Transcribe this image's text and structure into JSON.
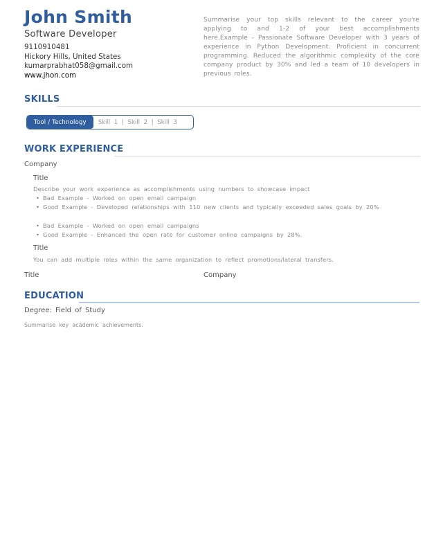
{
  "header": {
    "name": "John Smith",
    "role": "Software Developer",
    "phone": "9110910481",
    "location": "Hickory Hills, United States",
    "email": "kumarprabhat058@gmail.com",
    "website": "www.jhon.com",
    "summary": "Summarise your top skills relevant to the career you're applying to and 1-2 of your best accomplishments here.Example - Passionate Software Developer with 3 years of experience in Python Development. Proficient in concurrent programming. Reduced the algorithmic complexity of the core company product by 30% and led a team of 10 developers in previous roles."
  },
  "skills": {
    "title": "SKILLS",
    "category": "Tool / Technology",
    "list": "Skill 1 | Skill 2 | Skill 3"
  },
  "work": {
    "title": "WORK EXPERIENCE",
    "entries": [
      {
        "company": "Company",
        "roles": [
          {
            "title": "Title",
            "description": "Describe your work experience as accomplishments using numbers to showcase impact",
            "bullets_a": [
              "Bad Example - Worked on open email campaign",
              "Good Example - Developed relationships with 110 new clients and typically exceeded sales goals by 20%"
            ],
            "bullets_b": [
              "Bad Example - Worked on open email campaigns",
              "Good Example - Enhanced the open rate for customer online campaigns by 28%."
            ]
          },
          {
            "title": "Title",
            "description": "You can add multiple roles within the same organization to reflect promotions/lateral transfers."
          }
        ]
      },
      {
        "title": "Title",
        "company": "Company"
      }
    ]
  },
  "education": {
    "title": "EDUCATION",
    "degree": "Degree: Field of Study",
    "summary": "Summarise key academic achievements."
  },
  "colors": {
    "accent": "#2f5d9e",
    "rule": "#ccd6e2",
    "muted_text": "#8a8a8a"
  }
}
